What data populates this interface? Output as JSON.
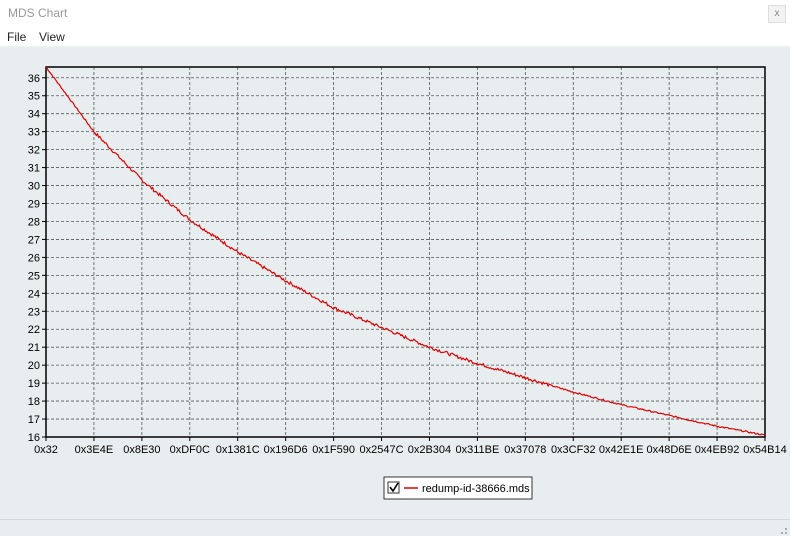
{
  "window": {
    "title": "MDS Chart",
    "close_label": "x"
  },
  "menu": {
    "items": [
      "File",
      "View"
    ]
  },
  "chart_data": {
    "type": "line",
    "title": "",
    "xlabel": "",
    "ylabel": "",
    "x_tick_labels": [
      "0x32",
      "0x3E4E",
      "0x8E30",
      "0xDF0C",
      "0x1381C",
      "0x196D6",
      "0x1F590",
      "0x2547C",
      "0x2B304",
      "0x311BE",
      "0x37078",
      "0x3CF32",
      "0x42E1E",
      "0x48D6E",
      "0x4EB92",
      "0x54B14"
    ],
    "ylim": [
      16,
      36.6
    ],
    "y_ticks": [
      16,
      17,
      18,
      19,
      20,
      21,
      22,
      23,
      24,
      25,
      26,
      27,
      28,
      29,
      30,
      31,
      32,
      33,
      34,
      35,
      36
    ],
    "grid": true,
    "series": [
      {
        "name": "redump-id-38666.mds",
        "color": "#e00000",
        "x": [
          "0x32",
          "0x3E4E",
          "0x8E30",
          "0xDF0C",
          "0x1381C",
          "0x196D6",
          "0x1F590",
          "0x2547C",
          "0x2B304",
          "0x311BE",
          "0x37078",
          "0x3CF32",
          "0x42E1E",
          "0x48D6E",
          "0x4EB92",
          "0x54B14"
        ],
        "values": [
          36.6,
          33.0,
          30.3,
          28.1,
          26.3,
          24.7,
          23.2,
          22.1,
          21.0,
          20.1,
          19.3,
          18.5,
          17.8,
          17.2,
          16.6,
          16.1
        ]
      }
    ],
    "legend": {
      "position": "bottom-center",
      "checked": true
    }
  },
  "colors": {
    "plot_bg": "#e8eef0",
    "line": "#e00000",
    "grid": "#555555"
  }
}
